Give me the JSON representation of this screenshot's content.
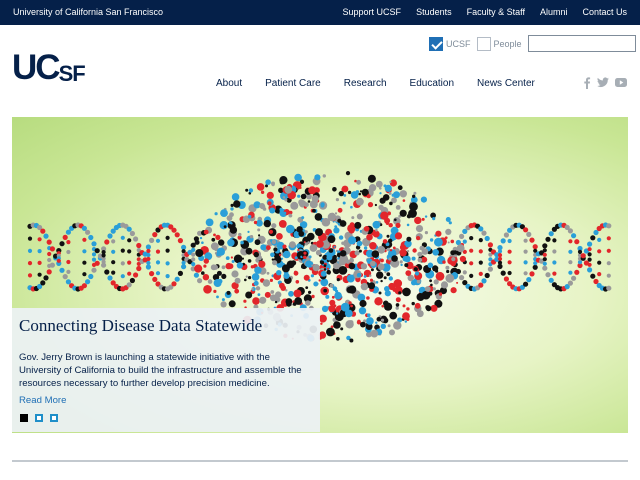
{
  "topbar": {
    "university": "University of California San Francisco",
    "links": [
      "Support UCSF",
      "Students",
      "Faculty & Staff",
      "Alumni",
      "Contact Us"
    ]
  },
  "logo": {
    "main": "UC",
    "sub": "SF"
  },
  "search": {
    "options": [
      {
        "label": "UCSF",
        "checked": true
      },
      {
        "label": "People",
        "checked": false
      }
    ],
    "value": ""
  },
  "nav": [
    "About",
    "Patient Care",
    "Research",
    "Education",
    "News Center"
  ],
  "social": [
    "facebook-icon",
    "twitter-icon",
    "youtube-icon"
  ],
  "hero": {
    "title": "Connecting Disease Data Statewide",
    "body": "Gov. Jerry Brown is launching a statewide initiative with the University of California to build the infrastructure and assemble the resources necessary to further develop precision medicine.",
    "read_more": "Read More",
    "slides": {
      "count": 3,
      "active": 1
    }
  },
  "colors": {
    "navy": "#052049",
    "link_blue": "#1f6fb5",
    "hero_green": "#c9e695",
    "dna_red": "#e2262b",
    "dna_blue": "#2a9fd8",
    "dna_black": "#111111",
    "dna_gray": "#9a9a9a"
  }
}
